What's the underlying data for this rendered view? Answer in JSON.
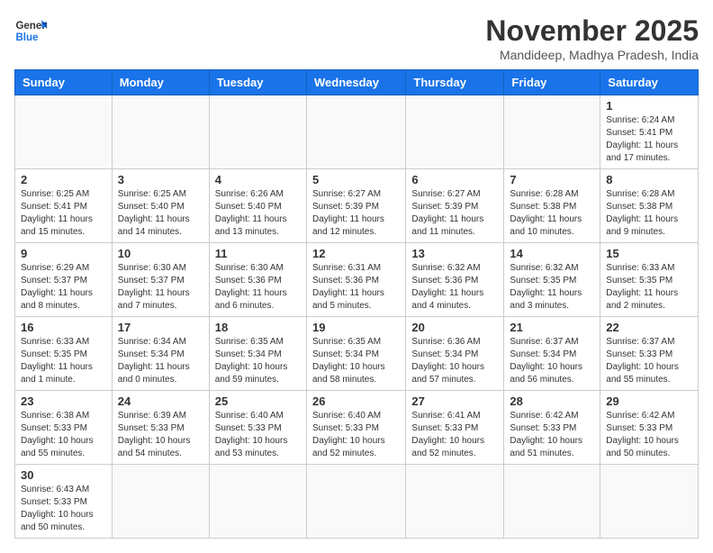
{
  "header": {
    "logo_general": "General",
    "logo_blue": "Blue",
    "month_title": "November 2025",
    "subtitle": "Mandideep, Madhya Pradesh, India"
  },
  "weekdays": [
    "Sunday",
    "Monday",
    "Tuesday",
    "Wednesday",
    "Thursday",
    "Friday",
    "Saturday"
  ],
  "weeks": [
    [
      {
        "day": "",
        "info": ""
      },
      {
        "day": "",
        "info": ""
      },
      {
        "day": "",
        "info": ""
      },
      {
        "day": "",
        "info": ""
      },
      {
        "day": "",
        "info": ""
      },
      {
        "day": "",
        "info": ""
      },
      {
        "day": "1",
        "info": "Sunrise: 6:24 AM\nSunset: 5:41 PM\nDaylight: 11 hours and 17 minutes."
      }
    ],
    [
      {
        "day": "2",
        "info": "Sunrise: 6:25 AM\nSunset: 5:41 PM\nDaylight: 11 hours and 15 minutes."
      },
      {
        "day": "3",
        "info": "Sunrise: 6:25 AM\nSunset: 5:40 PM\nDaylight: 11 hours and 14 minutes."
      },
      {
        "day": "4",
        "info": "Sunrise: 6:26 AM\nSunset: 5:40 PM\nDaylight: 11 hours and 13 minutes."
      },
      {
        "day": "5",
        "info": "Sunrise: 6:27 AM\nSunset: 5:39 PM\nDaylight: 11 hours and 12 minutes."
      },
      {
        "day": "6",
        "info": "Sunrise: 6:27 AM\nSunset: 5:39 PM\nDaylight: 11 hours and 11 minutes."
      },
      {
        "day": "7",
        "info": "Sunrise: 6:28 AM\nSunset: 5:38 PM\nDaylight: 11 hours and 10 minutes."
      },
      {
        "day": "8",
        "info": "Sunrise: 6:28 AM\nSunset: 5:38 PM\nDaylight: 11 hours and 9 minutes."
      }
    ],
    [
      {
        "day": "9",
        "info": "Sunrise: 6:29 AM\nSunset: 5:37 PM\nDaylight: 11 hours and 8 minutes."
      },
      {
        "day": "10",
        "info": "Sunrise: 6:30 AM\nSunset: 5:37 PM\nDaylight: 11 hours and 7 minutes."
      },
      {
        "day": "11",
        "info": "Sunrise: 6:30 AM\nSunset: 5:36 PM\nDaylight: 11 hours and 6 minutes."
      },
      {
        "day": "12",
        "info": "Sunrise: 6:31 AM\nSunset: 5:36 PM\nDaylight: 11 hours and 5 minutes."
      },
      {
        "day": "13",
        "info": "Sunrise: 6:32 AM\nSunset: 5:36 PM\nDaylight: 11 hours and 4 minutes."
      },
      {
        "day": "14",
        "info": "Sunrise: 6:32 AM\nSunset: 5:35 PM\nDaylight: 11 hours and 3 minutes."
      },
      {
        "day": "15",
        "info": "Sunrise: 6:33 AM\nSunset: 5:35 PM\nDaylight: 11 hours and 2 minutes."
      }
    ],
    [
      {
        "day": "16",
        "info": "Sunrise: 6:33 AM\nSunset: 5:35 PM\nDaylight: 11 hours and 1 minute."
      },
      {
        "day": "17",
        "info": "Sunrise: 6:34 AM\nSunset: 5:34 PM\nDaylight: 11 hours and 0 minutes."
      },
      {
        "day": "18",
        "info": "Sunrise: 6:35 AM\nSunset: 5:34 PM\nDaylight: 10 hours and 59 minutes."
      },
      {
        "day": "19",
        "info": "Sunrise: 6:35 AM\nSunset: 5:34 PM\nDaylight: 10 hours and 58 minutes."
      },
      {
        "day": "20",
        "info": "Sunrise: 6:36 AM\nSunset: 5:34 PM\nDaylight: 10 hours and 57 minutes."
      },
      {
        "day": "21",
        "info": "Sunrise: 6:37 AM\nSunset: 5:34 PM\nDaylight: 10 hours and 56 minutes."
      },
      {
        "day": "22",
        "info": "Sunrise: 6:37 AM\nSunset: 5:33 PM\nDaylight: 10 hours and 55 minutes."
      }
    ],
    [
      {
        "day": "23",
        "info": "Sunrise: 6:38 AM\nSunset: 5:33 PM\nDaylight: 10 hours and 55 minutes."
      },
      {
        "day": "24",
        "info": "Sunrise: 6:39 AM\nSunset: 5:33 PM\nDaylight: 10 hours and 54 minutes."
      },
      {
        "day": "25",
        "info": "Sunrise: 6:40 AM\nSunset: 5:33 PM\nDaylight: 10 hours and 53 minutes."
      },
      {
        "day": "26",
        "info": "Sunrise: 6:40 AM\nSunset: 5:33 PM\nDaylight: 10 hours and 52 minutes."
      },
      {
        "day": "27",
        "info": "Sunrise: 6:41 AM\nSunset: 5:33 PM\nDaylight: 10 hours and 52 minutes."
      },
      {
        "day": "28",
        "info": "Sunrise: 6:42 AM\nSunset: 5:33 PM\nDaylight: 10 hours and 51 minutes."
      },
      {
        "day": "29",
        "info": "Sunrise: 6:42 AM\nSunset: 5:33 PM\nDaylight: 10 hours and 50 minutes."
      }
    ],
    [
      {
        "day": "30",
        "info": "Sunrise: 6:43 AM\nSunset: 5:33 PM\nDaylight: 10 hours and 50 minutes."
      },
      {
        "day": "",
        "info": ""
      },
      {
        "day": "",
        "info": ""
      },
      {
        "day": "",
        "info": ""
      },
      {
        "day": "",
        "info": ""
      },
      {
        "day": "",
        "info": ""
      },
      {
        "day": "",
        "info": ""
      }
    ]
  ]
}
